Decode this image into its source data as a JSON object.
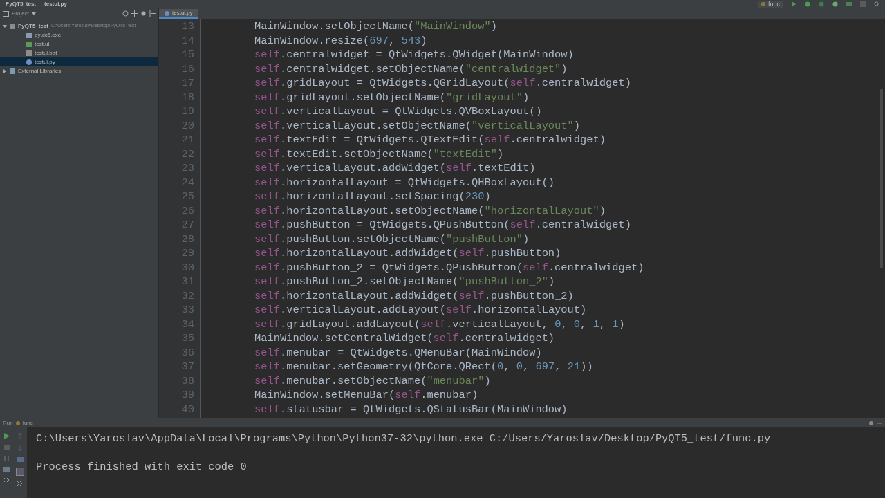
{
  "breadcrumbs": [
    "PyQT5_test",
    "testui.py"
  ],
  "run_config": {
    "label": "func"
  },
  "project_panel": {
    "title": "Project",
    "tree": [
      {
        "label": "PyQT5_test",
        "path": "C:\\Users\\Yaroslav\\Desktop\\PyQT5_test",
        "kind": "folder",
        "expanded": true,
        "selected": false,
        "children": [
          {
            "label": "pyuic5.exe",
            "kind": "exe",
            "selected": false
          },
          {
            "label": "test.ui",
            "kind": "ui",
            "selected": false
          },
          {
            "label": "testui.bat",
            "kind": "bat",
            "selected": false
          },
          {
            "label": "testui.py",
            "kind": "py",
            "selected": true
          }
        ]
      },
      {
        "label": "External Libraries",
        "kind": "library",
        "expanded": false,
        "selected": false
      }
    ]
  },
  "editor_tabs": [
    {
      "label": "testui.py",
      "selected": true
    }
  ],
  "code_lines": [
    {
      "number": "13",
      "tokens": [
        {
          "kind": "plain",
          "text": "MainWindow.setObjectName("
        },
        {
          "kind": "string",
          "text": "\"MainWindow\""
        },
        {
          "kind": "plain",
          "text": ")"
        }
      ]
    },
    {
      "number": "14",
      "tokens": [
        {
          "kind": "plain",
          "text": "MainWindow.resize("
        },
        {
          "kind": "number",
          "text": "697"
        },
        {
          "kind": "plain",
          "text": ", "
        },
        {
          "kind": "number",
          "text": "543"
        },
        {
          "kind": "plain",
          "text": ")"
        }
      ]
    },
    {
      "number": "15",
      "tokens": [
        {
          "kind": "self",
          "text": "self"
        },
        {
          "kind": "plain",
          "text": ".centralwidget = QtWidgets.QWidget(MainWindow)"
        }
      ]
    },
    {
      "number": "16",
      "tokens": [
        {
          "kind": "self",
          "text": "self"
        },
        {
          "kind": "plain",
          "text": ".centralwidget.setObjectName("
        },
        {
          "kind": "string",
          "text": "\"centralwidget\""
        },
        {
          "kind": "plain",
          "text": ")"
        }
      ]
    },
    {
      "number": "17",
      "tokens": [
        {
          "kind": "self",
          "text": "self"
        },
        {
          "kind": "plain",
          "text": ".gridLayout = QtWidgets.QGridLayout("
        },
        {
          "kind": "self",
          "text": "self"
        },
        {
          "kind": "plain",
          "text": ".centralwidget)"
        }
      ]
    },
    {
      "number": "18",
      "tokens": [
        {
          "kind": "self",
          "text": "self"
        },
        {
          "kind": "plain",
          "text": ".gridLayout.setObjectName("
        },
        {
          "kind": "string",
          "text": "\"gridLayout\""
        },
        {
          "kind": "plain",
          "text": ")"
        }
      ]
    },
    {
      "number": "19",
      "tokens": [
        {
          "kind": "self",
          "text": "self"
        },
        {
          "kind": "plain",
          "text": ".verticalLayout = QtWidgets.QVBoxLayout()"
        }
      ]
    },
    {
      "number": "20",
      "tokens": [
        {
          "kind": "self",
          "text": "self"
        },
        {
          "kind": "plain",
          "text": ".verticalLayout.setObjectName("
        },
        {
          "kind": "string",
          "text": "\"verticalLayout\""
        },
        {
          "kind": "plain",
          "text": ")"
        }
      ]
    },
    {
      "number": "21",
      "tokens": [
        {
          "kind": "self",
          "text": "self"
        },
        {
          "kind": "plain",
          "text": ".textEdit = QtWidgets.QTextEdit("
        },
        {
          "kind": "self",
          "text": "self"
        },
        {
          "kind": "plain",
          "text": ".centralwidget)"
        }
      ]
    },
    {
      "number": "22",
      "tokens": [
        {
          "kind": "self",
          "text": "self"
        },
        {
          "kind": "plain",
          "text": ".textEdit.setObjectName("
        },
        {
          "kind": "string",
          "text": "\"textEdit\""
        },
        {
          "kind": "plain",
          "text": ")"
        }
      ]
    },
    {
      "number": "23",
      "tokens": [
        {
          "kind": "self",
          "text": "self"
        },
        {
          "kind": "plain",
          "text": ".verticalLayout.addWidget("
        },
        {
          "kind": "self",
          "text": "self"
        },
        {
          "kind": "plain",
          "text": ".textEdit)"
        }
      ]
    },
    {
      "number": "24",
      "tokens": [
        {
          "kind": "self",
          "text": "self"
        },
        {
          "kind": "plain",
          "text": ".horizontalLayout = QtWidgets.QHBoxLayout()"
        }
      ]
    },
    {
      "number": "25",
      "tokens": [
        {
          "kind": "self",
          "text": "self"
        },
        {
          "kind": "plain",
          "text": ".horizontalLayout.setSpacing("
        },
        {
          "kind": "number",
          "text": "230"
        },
        {
          "kind": "plain",
          "text": ")"
        }
      ]
    },
    {
      "number": "26",
      "tokens": [
        {
          "kind": "self",
          "text": "self"
        },
        {
          "kind": "plain",
          "text": ".horizontalLayout.setObjectName("
        },
        {
          "kind": "string",
          "text": "\"horizontalLayout\""
        },
        {
          "kind": "plain",
          "text": ")"
        }
      ]
    },
    {
      "number": "27",
      "tokens": [
        {
          "kind": "self",
          "text": "self"
        },
        {
          "kind": "plain",
          "text": ".pushButton = QtWidgets.QPushButton("
        },
        {
          "kind": "self",
          "text": "self"
        },
        {
          "kind": "plain",
          "text": ".centralwidget)"
        }
      ]
    },
    {
      "number": "28",
      "tokens": [
        {
          "kind": "self",
          "text": "self"
        },
        {
          "kind": "plain",
          "text": ".pushButton.setObjectName("
        },
        {
          "kind": "string",
          "text": "\"pushButton\""
        },
        {
          "kind": "plain",
          "text": ")"
        }
      ]
    },
    {
      "number": "29",
      "tokens": [
        {
          "kind": "self",
          "text": "self"
        },
        {
          "kind": "plain",
          "text": ".horizontalLayout.addWidget("
        },
        {
          "kind": "self",
          "text": "self"
        },
        {
          "kind": "plain",
          "text": ".pushButton)"
        }
      ]
    },
    {
      "number": "30",
      "tokens": [
        {
          "kind": "self",
          "text": "self"
        },
        {
          "kind": "plain",
          "text": ".pushButton_2 = QtWidgets.QPushButton("
        },
        {
          "kind": "self",
          "text": "self"
        },
        {
          "kind": "plain",
          "text": ".centralwidget)"
        }
      ]
    },
    {
      "number": "31",
      "tokens": [
        {
          "kind": "self",
          "text": "self"
        },
        {
          "kind": "plain",
          "text": ".pushButton_2.setObjectName("
        },
        {
          "kind": "string",
          "text": "\"pushButton_2\""
        },
        {
          "kind": "plain",
          "text": ")"
        }
      ]
    },
    {
      "number": "32",
      "tokens": [
        {
          "kind": "self",
          "text": "self"
        },
        {
          "kind": "plain",
          "text": ".horizontalLayout.addWidget("
        },
        {
          "kind": "self",
          "text": "self"
        },
        {
          "kind": "plain",
          "text": ".pushButton_2)"
        }
      ]
    },
    {
      "number": "33",
      "tokens": [
        {
          "kind": "self",
          "text": "self"
        },
        {
          "kind": "plain",
          "text": ".verticalLayout.addLayout("
        },
        {
          "kind": "self",
          "text": "self"
        },
        {
          "kind": "plain",
          "text": ".horizontalLayout)"
        }
      ]
    },
    {
      "number": "34",
      "tokens": [
        {
          "kind": "self",
          "text": "self"
        },
        {
          "kind": "plain",
          "text": ".gridLayout.addLayout("
        },
        {
          "kind": "self",
          "text": "self"
        },
        {
          "kind": "plain",
          "text": ".verticalLayout, "
        },
        {
          "kind": "number",
          "text": "0"
        },
        {
          "kind": "plain",
          "text": ", "
        },
        {
          "kind": "number",
          "text": "0"
        },
        {
          "kind": "plain",
          "text": ", "
        },
        {
          "kind": "number",
          "text": "1"
        },
        {
          "kind": "plain",
          "text": ", "
        },
        {
          "kind": "number",
          "text": "1"
        },
        {
          "kind": "plain",
          "text": ")"
        }
      ]
    },
    {
      "number": "35",
      "tokens": [
        {
          "kind": "plain",
          "text": "MainWindow.setCentralWidget("
        },
        {
          "kind": "self",
          "text": "self"
        },
        {
          "kind": "plain",
          "text": ".centralwidget)"
        }
      ]
    },
    {
      "number": "36",
      "tokens": [
        {
          "kind": "self",
          "text": "self"
        },
        {
          "kind": "plain",
          "text": ".menubar = QtWidgets.QMenuBar(MainWindow)"
        }
      ]
    },
    {
      "number": "37",
      "tokens": [
        {
          "kind": "self",
          "text": "self"
        },
        {
          "kind": "plain",
          "text": ".menubar.setGeometry(QtCore.QRect("
        },
        {
          "kind": "number",
          "text": "0"
        },
        {
          "kind": "plain",
          "text": ", "
        },
        {
          "kind": "number",
          "text": "0"
        },
        {
          "kind": "plain",
          "text": ", "
        },
        {
          "kind": "number",
          "text": "697"
        },
        {
          "kind": "plain",
          "text": ", "
        },
        {
          "kind": "number",
          "text": "21"
        },
        {
          "kind": "plain",
          "text": "))"
        }
      ]
    },
    {
      "number": "38",
      "tokens": [
        {
          "kind": "self",
          "text": "self"
        },
        {
          "kind": "plain",
          "text": ".menubar.setObjectName("
        },
        {
          "kind": "string",
          "text": "\"menubar\""
        },
        {
          "kind": "plain",
          "text": ")"
        }
      ]
    },
    {
      "number": "39",
      "tokens": [
        {
          "kind": "plain",
          "text": "MainWindow.setMenuBar("
        },
        {
          "kind": "self",
          "text": "self"
        },
        {
          "kind": "plain",
          "text": ".menubar)"
        }
      ]
    },
    {
      "number": "40",
      "tokens": [
        {
          "kind": "self",
          "text": "self"
        },
        {
          "kind": "plain",
          "text": ".statusbar = QtWidgets.QStatusBar(MainWindow)"
        }
      ]
    }
  ],
  "run_panel": {
    "title": "Run",
    "config": "func",
    "output": [
      "C:\\Users\\Yaroslav\\AppData\\Local\\Programs\\Python\\Python37-32\\python.exe C:/Users/Yaroslav/Desktop/PyQT5_test/func.py",
      "Process finished with exit code 0"
    ]
  }
}
